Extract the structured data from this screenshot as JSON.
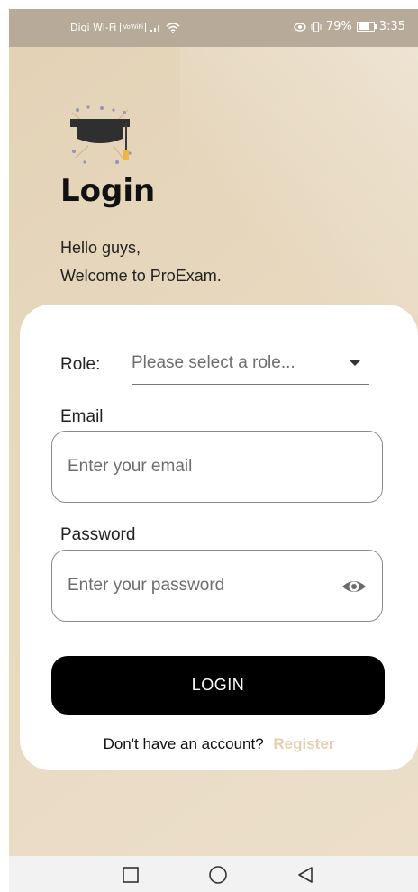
{
  "status_bar": {
    "carrier": "Digi Wi-Fi",
    "volte": "VoWiFi",
    "battery_percent": "79%",
    "battery_level": 0.79,
    "time": "3:35"
  },
  "header": {
    "title": "Login",
    "greeting_line1": "Hello guys,",
    "greeting_line2": "Welcome to ProExam."
  },
  "form": {
    "role_label": "Role:",
    "role_placeholder": "Please select a role...",
    "email_label": "Email",
    "email_placeholder": "Enter your email",
    "password_label": "Password",
    "password_placeholder": "Enter your password",
    "login_label": "LOGIN",
    "no_account_text": "Don't have an account?",
    "register_label": "Register"
  },
  "colors": {
    "background": "#e9dcc5",
    "accent": "#e6d0ae",
    "button": "#000000"
  },
  "icons": [
    "graduation-cap-icon",
    "eye-icon",
    "wifi-icon",
    "signal-icon",
    "battery-icon",
    "square-icon",
    "circle-icon",
    "back-triangle-icon"
  ]
}
